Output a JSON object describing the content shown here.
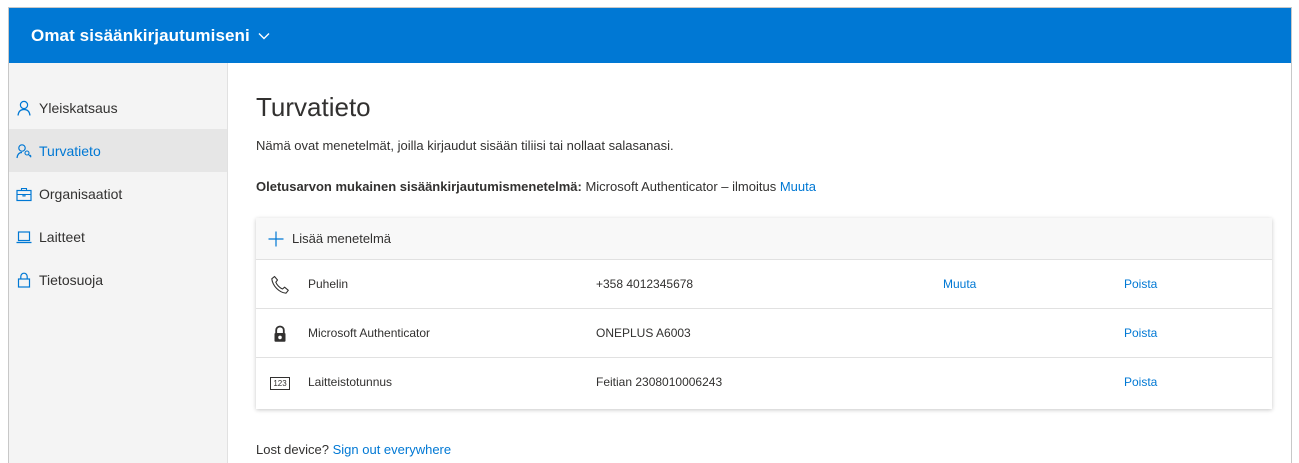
{
  "header": {
    "title": "Omat sisäänkirjautumiseni",
    "chevron_icon": "chevron-down-icon",
    "bg_color": "#0078d4"
  },
  "sidebar": {
    "items": [
      {
        "label": "Yleiskatsaus",
        "icon": "person-icon",
        "active": false
      },
      {
        "label": "Turvatieto",
        "icon": "person-key-icon",
        "active": true
      },
      {
        "label": "Organisaatiot",
        "icon": "briefcase-icon",
        "active": false
      },
      {
        "label": "Laitteet",
        "icon": "laptop-icon",
        "active": false
      },
      {
        "label": "Tietosuoja",
        "icon": "lock-icon",
        "active": false
      }
    ]
  },
  "main": {
    "title": "Turvatieto",
    "description": "Nämä ovat menetelmät, joilla kirjaudut sisään tiliisi tai nollaat salasanasi.",
    "default_label": "Oletusarvon mukainen sisäänkirjautumismenetelmä:",
    "default_value": " Microsoft Authenticator – ilmoitus ",
    "default_change": "Muuta",
    "add_method": "Lisää menetelmä",
    "methods": [
      {
        "icon": "phone-icon",
        "name": "Puhelin",
        "detail": "+358 4012345678",
        "change": "Muuta",
        "delete": "Poista"
      },
      {
        "icon": "authenticator-lock-icon",
        "name": "Microsoft Authenticator",
        "detail": "ONEPLUS A6003",
        "change": "",
        "delete": "Poista"
      },
      {
        "icon": "hardware-token-icon",
        "icon_text": "123",
        "name": "Laitteistotunnus",
        "detail": "Feitian 2308010006243",
        "change": "",
        "delete": "Poista"
      }
    ],
    "lost_device_text": "Lost device? ",
    "sign_out_link": "Sign out everywhere"
  }
}
